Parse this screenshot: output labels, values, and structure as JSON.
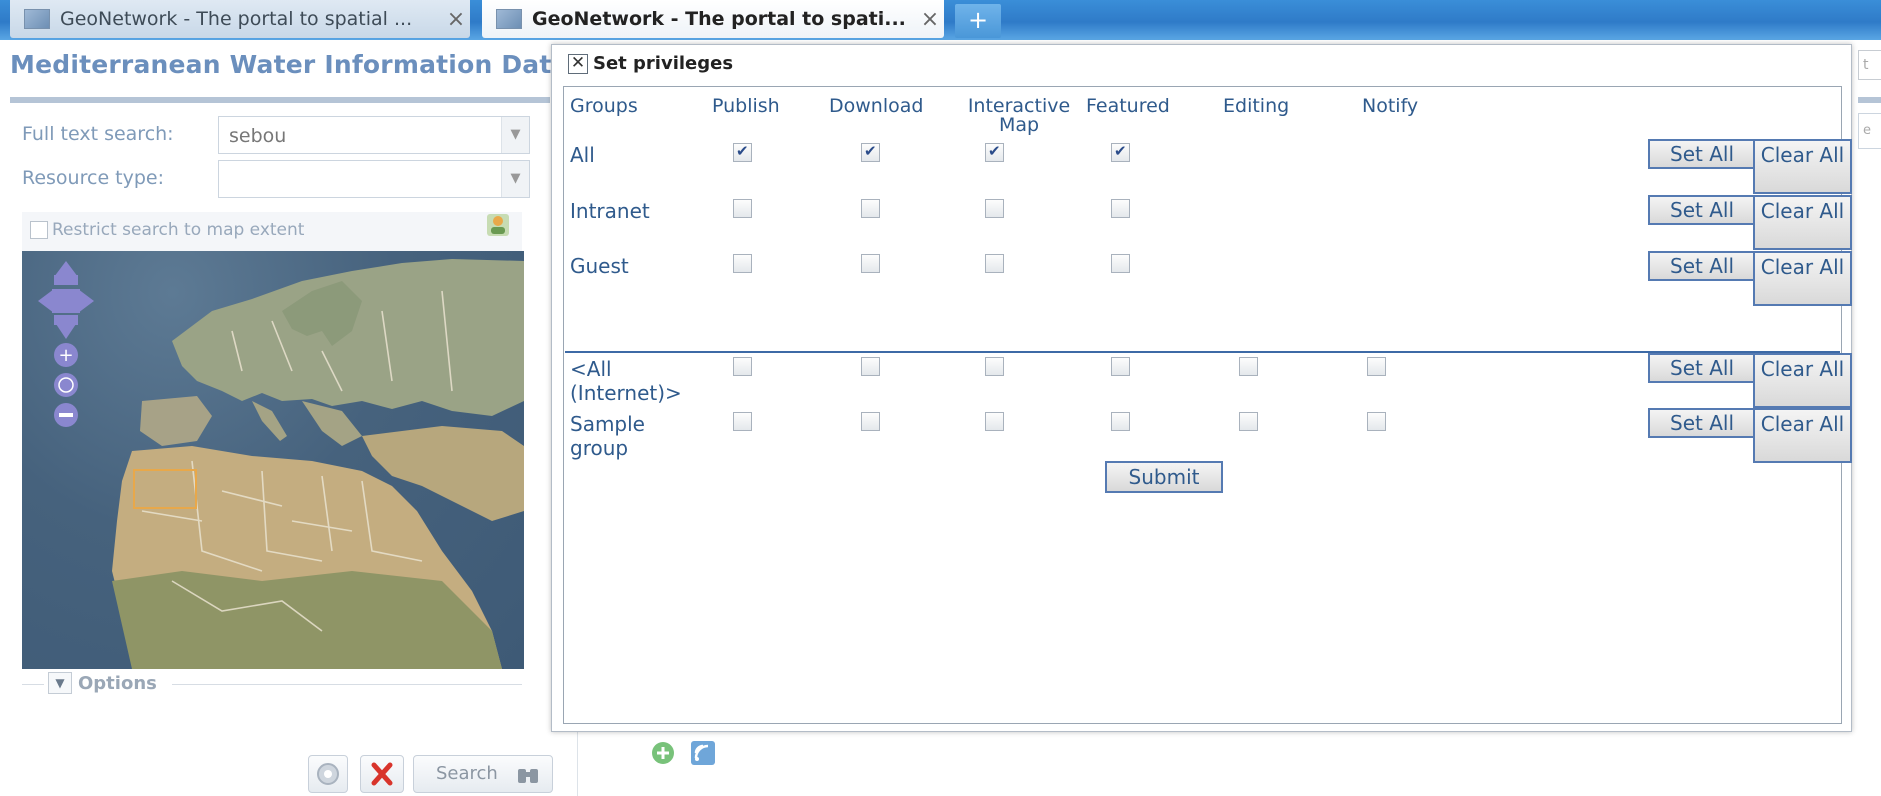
{
  "browser": {
    "tabs": [
      {
        "title": "GeoNetwork - The portal to spatial ...",
        "close": "×"
      },
      {
        "title": "GeoNetwork - The portal to spati...",
        "close": "×"
      }
    ],
    "new_tab": "+"
  },
  "search_panel": {
    "title": "Mediterranean Water Information Datas",
    "full_text_label": "Full text search:",
    "full_text_value": "sebou",
    "resource_type_label": "Resource type:",
    "resource_type_value": "",
    "restrict_label": "Restrict search to map extent",
    "options_label": "Options",
    "search_button": "Search"
  },
  "dialog": {
    "title": "Set privileges",
    "columns": [
      "Groups",
      "Publish",
      "Download",
      "Interactive Map",
      "Featured",
      "Editing",
      "Notify"
    ],
    "rows": [
      {
        "name": "All",
        "checks": [
          true,
          true,
          true,
          true
        ]
      },
      {
        "name": "Intranet",
        "checks": [
          false,
          false,
          false,
          false
        ]
      },
      {
        "name": "Guest",
        "checks": [
          false,
          false,
          false,
          false
        ]
      },
      {
        "name": "<All (Internet)>",
        "checks": [
          false,
          false,
          false,
          false,
          false,
          false
        ]
      },
      {
        "name": "Sample group",
        "checks": [
          false,
          false,
          false,
          false,
          false,
          false
        ]
      }
    ],
    "set_all_label": "Set All",
    "clear_all_label": "Clear All",
    "submit_label": "Submit"
  },
  "colors": {
    "accent_blue": "#2f5a8c",
    "title_blue": "#6b8fbd",
    "tabbar": "#2f7bc8"
  }
}
